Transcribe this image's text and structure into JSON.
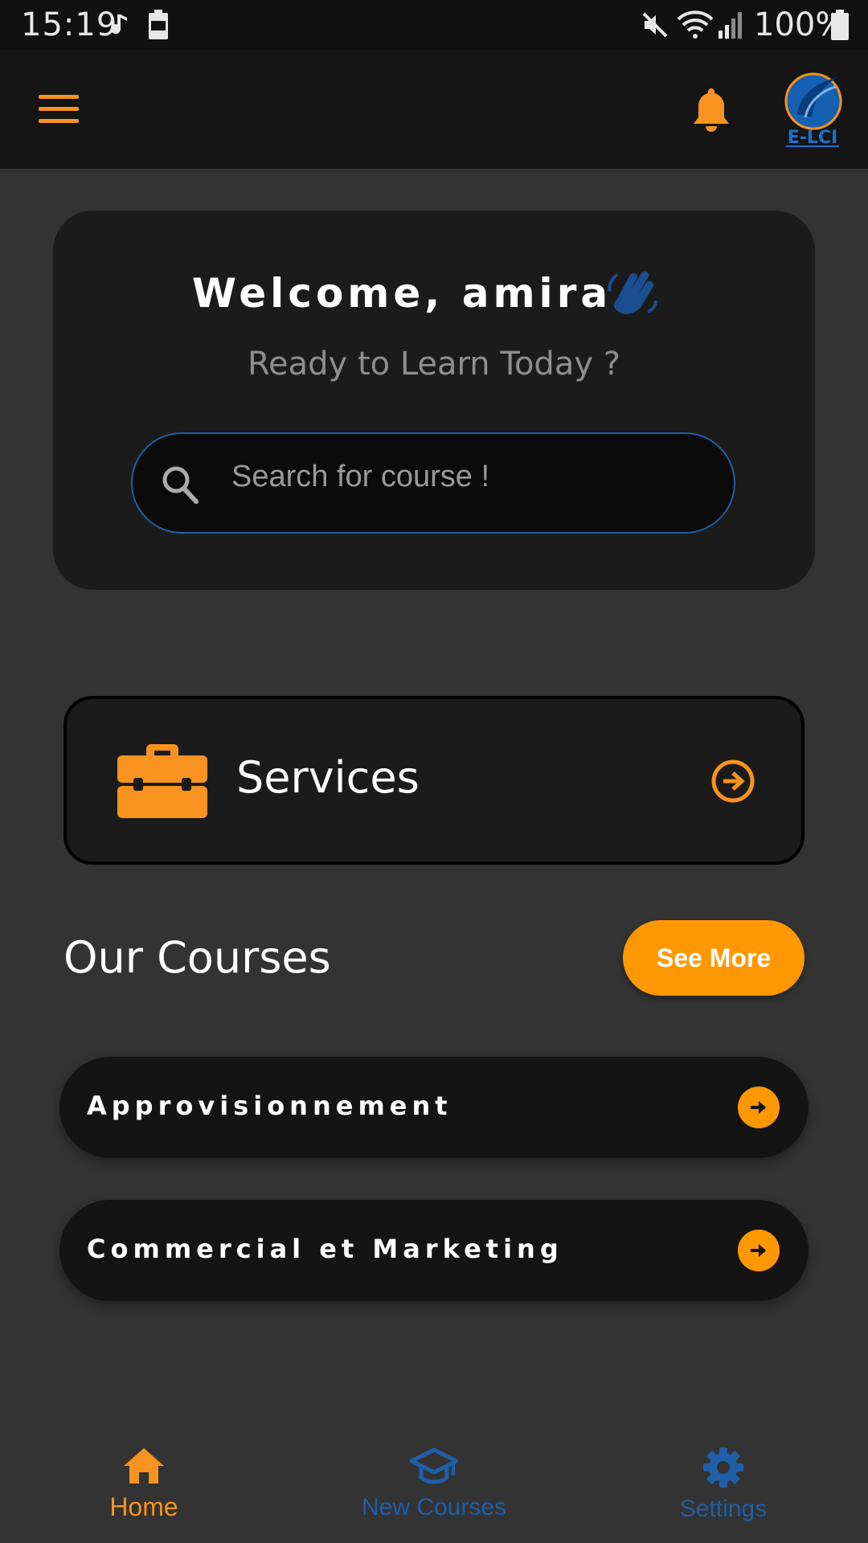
{
  "status_bar": {
    "time": "15:19",
    "battery_percent": "100%"
  },
  "app_bar": {
    "menu_icon": "hamburger-menu-icon",
    "notification_icon": "bell-icon",
    "logo_text": "E-LCI"
  },
  "welcome": {
    "title": "Welcome, amira",
    "icon": "waving-hand-icon",
    "subtitle": "Ready to Learn Today ?"
  },
  "search": {
    "placeholder": "Search for course !",
    "value": ""
  },
  "services": {
    "label": "Services",
    "icon": "briefcase-icon"
  },
  "courses": {
    "heading": "Our Courses",
    "see_more_label": "See More",
    "items": [
      {
        "label": "Approvisionnement"
      },
      {
        "label": "Commercial et Marketing"
      }
    ]
  },
  "bottom_nav": {
    "items": [
      {
        "label": "Home",
        "icon": "home-icon",
        "active": true
      },
      {
        "label": "New Courses",
        "icon": "graduation-cap-icon",
        "active": false
      },
      {
        "label": "Settings",
        "icon": "gear-icon",
        "active": false
      }
    ]
  },
  "colors": {
    "accent": "#ff9800",
    "secondary": "#1f5fa8",
    "background": "#333333",
    "card": "#1b1b1b"
  }
}
